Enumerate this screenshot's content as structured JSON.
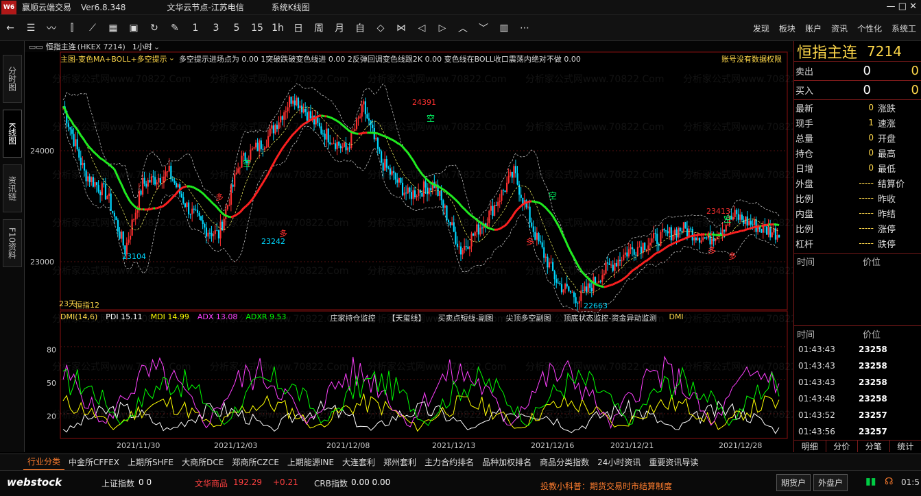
{
  "window": {
    "title": "赢顺云端交易",
    "version": "Ver6.8.348",
    "server": "文华云节点-江苏电信",
    "subtitle": "系统K线图",
    "controls": "—  □  ✕"
  },
  "toolbar": {
    "icons": [
      "back-arrow-icon",
      "list-icon",
      "line-chart-icon",
      "candlestick-icon",
      "fan-icon",
      "grid-icon",
      "save-icon",
      "refresh-icon",
      "draw-icon"
    ],
    "periods": [
      "1",
      "3",
      "5",
      "15",
      "1h",
      "日",
      "周",
      "月",
      "自"
    ],
    "nav_icons": [
      "expand-icon",
      "shrink-icon",
      "left-icon",
      "right-icon",
      "up-icon",
      "down-icon",
      "layout-icon",
      "more-icon"
    ],
    "right": [
      "发现",
      "板块",
      "账户",
      "资讯",
      "个性化",
      "系统工"
    ]
  },
  "lefttabs": [
    {
      "label": "分时图"
    },
    {
      "label": "K线图"
    },
    {
      "label": "资讯链"
    },
    {
      "label": "F10资料"
    }
  ],
  "chart": {
    "name": "恒指主连",
    "code": "(HKEX 7214)",
    "period": "1小时",
    "main_label": "主图-变色MA+BOLL+多空提示",
    "indicators": "多空提示进场点为 0.00  1突破跌破变色线进 0.00  2反弹回调变色线跟2K 0.00  变色线在BOLL收口震荡内绝对不做 0.00",
    "no_data": "账号没有数据权限",
    "ylabels": [
      "24000",
      "23000"
    ],
    "peaks": [
      "24391",
      "23104",
      "23242",
      "22663",
      "23413"
    ],
    "signals": [
      "空",
      "多",
      "多",
      "空",
      "空",
      "多",
      "空",
      "多",
      "多"
    ],
    "bars_label": "23天",
    "sub_label": "恒指12"
  },
  "dmi": {
    "name": "DMI(14,6)",
    "pdi": "PDI 15.11",
    "mdi": "MDI 14.99",
    "adx": "ADX 13.08",
    "adxr": "ADXR 9.53",
    "tools": [
      "庄家持仓监控",
      "【天玺线】",
      "买卖点短线-副图",
      "尖顶多空副图",
      "顶底状态监控-资金异动监测",
      "DMI"
    ],
    "ylabels": [
      "80",
      "50",
      "20"
    ],
    "dates": [
      "2021/11/30",
      "2021/12/03",
      "2021/12/08",
      "2021/12/13",
      "2021/12/16",
      "2021/12/21",
      "2021/12/28"
    ]
  },
  "colors": {
    "pdi": "#ffffff",
    "mdi": "#ffff00",
    "adx": "#ff40ff",
    "adxr": "#00ff00",
    "ma_up": "#ff2020",
    "ma_down": "#20ee20",
    "bull": "#ff3030",
    "bear": "#00d8ff",
    "accent": "#ff7d2e"
  },
  "quote": {
    "name": "恒指主连",
    "code": "7214",
    "sell_label": "卖出",
    "sell_val": "0",
    "sell_vol": "0",
    "buy_label": "买入",
    "buy_val": "0",
    "buy_vol": "0",
    "rows": [
      [
        "最新",
        "0",
        "涨跌",
        ""
      ],
      [
        "现手",
        "1",
        "速涨",
        ""
      ],
      [
        "总量",
        "0",
        "开盘",
        ""
      ],
      [
        "持仓",
        "0",
        "最高",
        ""
      ],
      [
        "日增",
        "0",
        "最低",
        ""
      ],
      [
        "外盘",
        "-----",
        "结算价",
        ""
      ],
      [
        "比例",
        "-----",
        "昨收",
        ""
      ],
      [
        "内盘",
        "-----",
        "昨结",
        ""
      ],
      [
        "比例",
        "-----",
        "涨停",
        ""
      ],
      [
        "杠杆",
        "-----",
        "跌停",
        ""
      ]
    ],
    "time_label": "时间",
    "price_label": "价位",
    "ticks": [
      [
        "01:43:43",
        "23258"
      ],
      [
        "01:43:43",
        "23258"
      ],
      [
        "01:43:43",
        "23258"
      ],
      [
        "01:43:48",
        "23258"
      ],
      [
        "01:43:52",
        "23257"
      ],
      [
        "01:43:56",
        "23257"
      ]
    ],
    "tabs": [
      "明细",
      "分价",
      "分笔",
      "统计"
    ]
  },
  "bottom": {
    "tabs": [
      "行业分类",
      "中金所CFFEX",
      "上期所SHFE",
      "大商所DCE",
      "郑商所CZCE",
      "上期能源INE",
      "大连套利",
      "郑州套利",
      "主力合约排名",
      "品种加权排名",
      "商品分类指数",
      "24小时资讯",
      "重要资讯导读"
    ]
  },
  "status": {
    "brand": "webstock",
    "sh_label": "上证指数",
    "sh_val": "0 0",
    "wh_label": "文华商品",
    "wh_val": "192.29",
    "wh_chg": "+0.21",
    "crb_label": "CRB指数",
    "crb_val": "0.00  0.00",
    "notice": "投教小科普：期货交易时市结算制度",
    "btn1": "期货户",
    "btn2": "外盘户",
    "time": "01:5"
  },
  "watermark": "分析家公式网www.70822.Com"
}
